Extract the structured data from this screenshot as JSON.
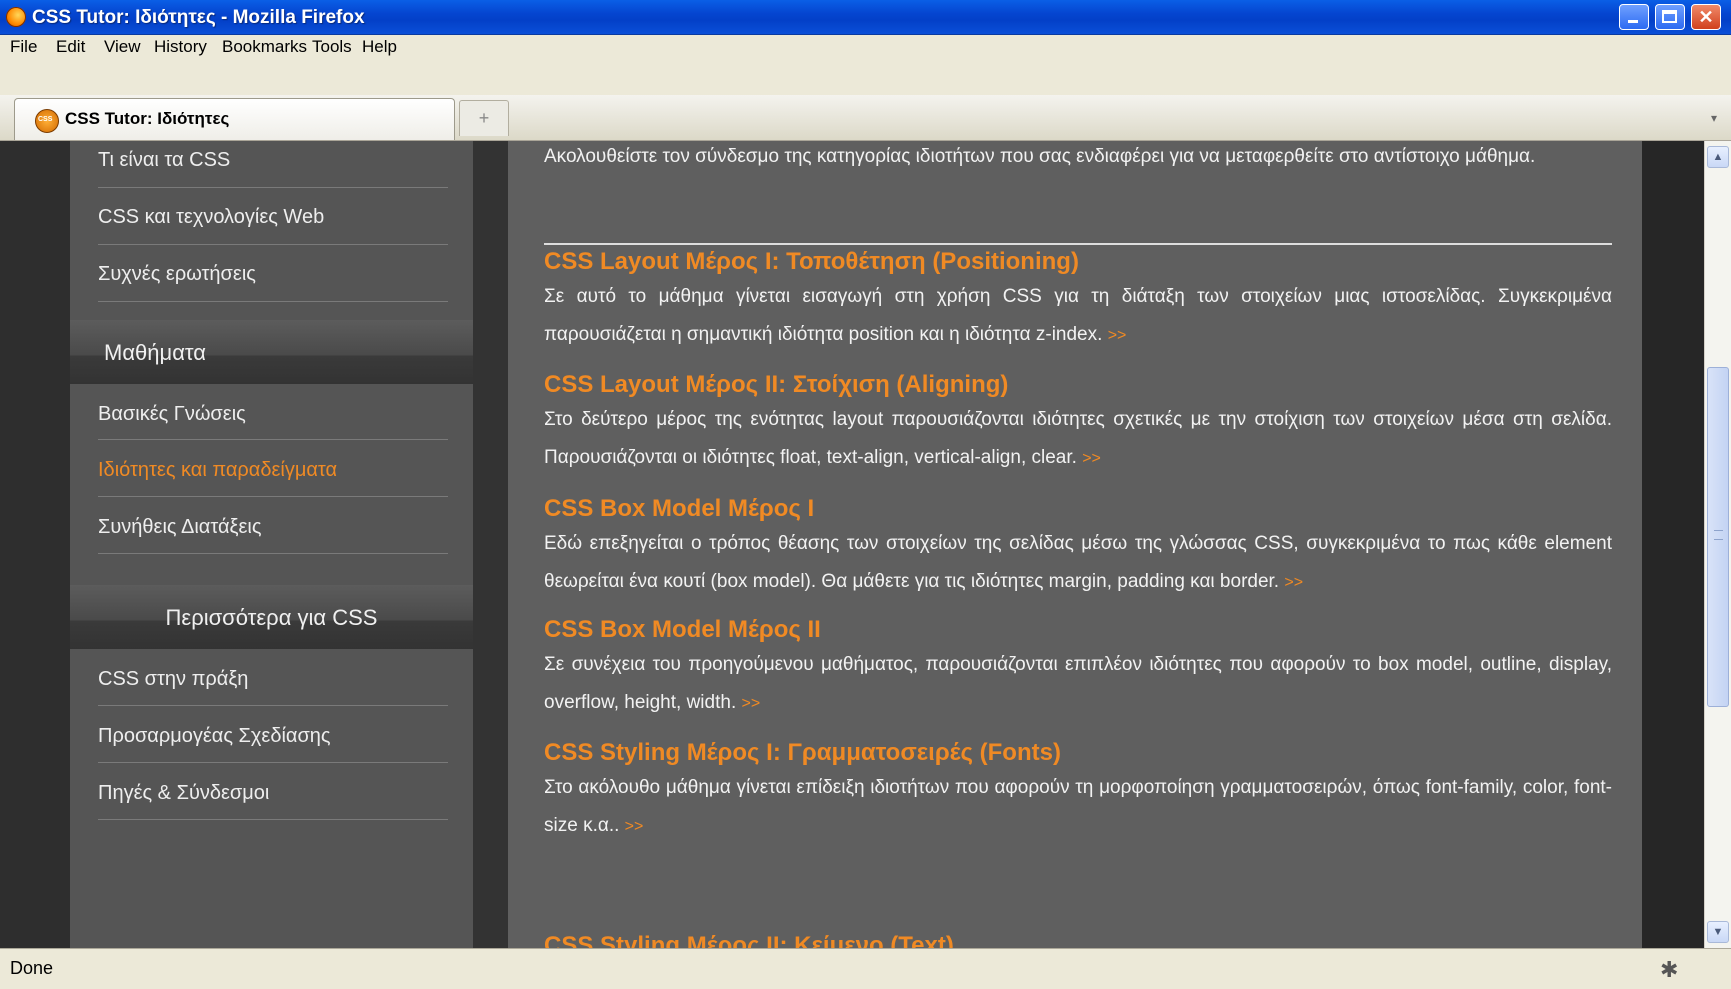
{
  "window": {
    "title": "CSS Tutor: Ιδιότητες - Mozilla Firefox"
  },
  "menu": [
    "File",
    "Edit",
    "View",
    "History",
    "Bookmarks",
    "Tools",
    "Help"
  ],
  "tab": {
    "label": "CSS Tutor: Ιδιότητες",
    "new_tab_glyph": "+"
  },
  "sidebar": {
    "top_items": [
      "Τι είναι τα CSS",
      "CSS και τεχνολογίες Web",
      "Συχνές ερωτήσεις"
    ],
    "sections": [
      {
        "title": "Μαθήματα",
        "items": [
          "Βασικές Γνώσεις",
          "Ιδιότητες και παραδείγματα",
          "Συνήθεις Διατάξεις"
        ]
      },
      {
        "title": "Περισσότερα για CSS",
        "items": [
          "CSS στην πράξη",
          "Προσαρμογέας Σχεδίασης",
          "Πηγές & Σύνδεσμοι"
        ]
      }
    ],
    "active_item": "Ιδιότητες και παραδείγματα"
  },
  "content": {
    "intro": "Ακολουθείστε τον σύνδεσμο της κατηγορίας ιδιοτήτων που σας ενδιαφέρει για να μεταφερθείτε στο αντίστοιχο μάθημα.",
    "more_link": ">>",
    "lessons": [
      {
        "title": "CSS Layout Μέρος I: Τοποθέτηση (Positioning)",
        "text": "Σε αυτό το μάθημα γίνεται εισαγωγή στη χρήση CSS για τη διάταξη των στοιχείων μιας ιστοσελίδας. Συγκεκριμένα παρουσιάζεται η σημαντική ιδιότητα position και η ιδιότητα z-index."
      },
      {
        "title": "CSS Layout Μέρος II: Στοίχιση (Aligning)",
        "text": "Στο δεύτερο μέρος της ενότητας layout παρουσιάζονται ιδιότητες σχετικές με την στοίχιση των στοιχείων μέσα στη σελίδα. Παρουσιάζονται οι ιδιότητες float, text-align, vertical-align, clear."
      },
      {
        "title": "CSS Box Model Μέρος I",
        "text": "Εδώ επεξηγείται ο τρόπος θέασης των στοιχείων της σελίδας μέσω της γλώσσας CSS, συγκεκριμένα το πως κάθε element θεωρείται ένα κουτί (box model). Θα μάθετε για τις ιδιότητες margin, padding και border."
      },
      {
        "title": "CSS Box Model Μέρος II",
        "text": "Σε συνέχεια του προηγούμενου μαθήματος, παρουσιάζονται επιπλέον ιδιότητες που αφορούν το box model, outline, display, overflow, height, width."
      },
      {
        "title": "CSS Styling Μέρος I: Γραμματοσειρές (Fonts)",
        "text": "Στο ακόλουθο μάθημα γίνεται επίδειξη ιδιοτήτων που αφορούν τη μορφοποίηση γραμματοσειρών, όπως font-family, color, font-size κ.α.."
      },
      {
        "title": "CSS Styling Μέρος II: Κείμενο (Text)",
        "text": ""
      }
    ]
  },
  "status": {
    "text": "Done"
  },
  "colors": {
    "accent": "#f08a24",
    "content_bg": "#5f5f5f",
    "sidebar_bg": "#555555",
    "titlebar": "#0545d0"
  }
}
